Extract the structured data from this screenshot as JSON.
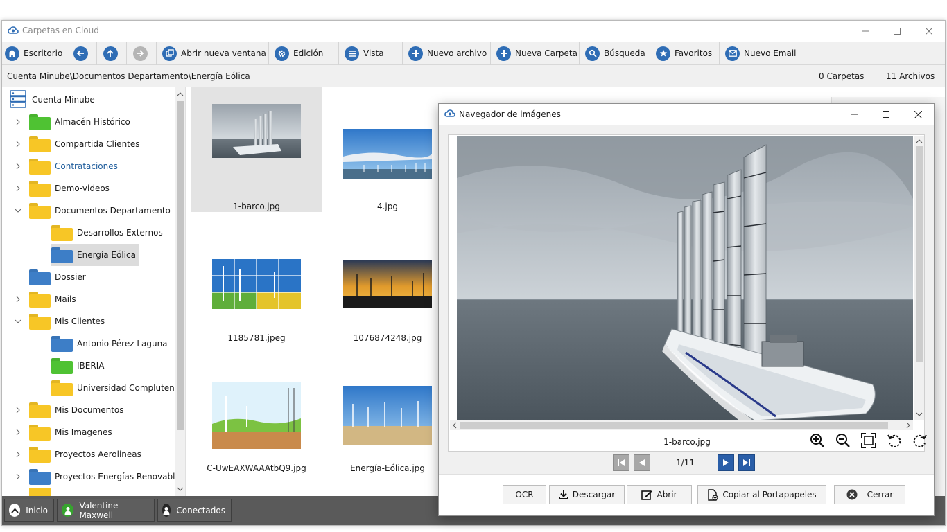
{
  "window": {
    "title": "Carpetas en Cloud"
  },
  "toolbar": {
    "desktop": "Escritorio",
    "new_window": "Abrir nueva ventana",
    "edit": "Edición",
    "view": "Vista",
    "new_file": "Nuevo archivo",
    "new_folder": "Nueva Carpeta",
    "search": "Búsqueda",
    "favorites": "Favoritos",
    "new_email": "Nuevo Email"
  },
  "pathbar": {
    "path": "Cuenta Minube\\Documentos Departamento\\Energía Eólica",
    "folders_count": "0 Carpetas",
    "files_count": "11 Archivos"
  },
  "tree": {
    "root": "Cuenta Minube",
    "items": [
      {
        "label": "Almacén Histórico",
        "color": "green"
      },
      {
        "label": "Compartida Clientes",
        "color": "yellow"
      },
      {
        "label": "Contrataciones",
        "color": "yellow"
      },
      {
        "label": "Demo-videos",
        "color": "yellow"
      },
      {
        "label": "Documentos Departamento",
        "color": "yellow"
      },
      {
        "label": "Desarrollos Externos",
        "color": "yellow"
      },
      {
        "label": "Energía Eólica",
        "color": "blue"
      },
      {
        "label": "Dossier",
        "color": "blue"
      },
      {
        "label": "Mails",
        "color": "yellow"
      },
      {
        "label": "Mis Clientes",
        "color": "yellow"
      },
      {
        "label": "Antonio Pérez Laguna",
        "color": "blue"
      },
      {
        "label": "IBERIA",
        "color": "green"
      },
      {
        "label": "Universidad Complutense",
        "color": "yellow"
      },
      {
        "label": "Mis Documentos",
        "color": "yellow"
      },
      {
        "label": "Mis Imagenes",
        "color": "yellow"
      },
      {
        "label": "Proyectos Aerolineas",
        "color": "yellow"
      },
      {
        "label": "Proyectos Energías Renovables",
        "color": "blue"
      }
    ]
  },
  "files": [
    {
      "name": "1-barco.jpg",
      "selected": true
    },
    {
      "name": "4.jpg"
    },
    {
      "name": "1185781.jpeg"
    },
    {
      "name": "1076874248.jpg"
    },
    {
      "name": "C-UwEAXWAAAtbQ9.jpg"
    },
    {
      "name": "Energía-Eólica.jpg"
    }
  ],
  "taskbar": {
    "start": "Inicio",
    "user": "Valentine Maxwell",
    "connected": "Conectados"
  },
  "viewer": {
    "title": "Navegador de imágenes",
    "filename": "1-barco.jpg",
    "page_counter": "1/11",
    "buttons": {
      "ocr": "OCR",
      "download": "Descargar",
      "open": "Abrir",
      "copy": "Copiar al Portapapeles",
      "close": "Cerrar"
    }
  },
  "colors": {
    "accent": "#2f6db5",
    "folder_yellow": "#f7c626",
    "folder_green": "#4fc233",
    "folder_blue": "#3d7ec7",
    "taskbar": "#5a5a5a"
  }
}
